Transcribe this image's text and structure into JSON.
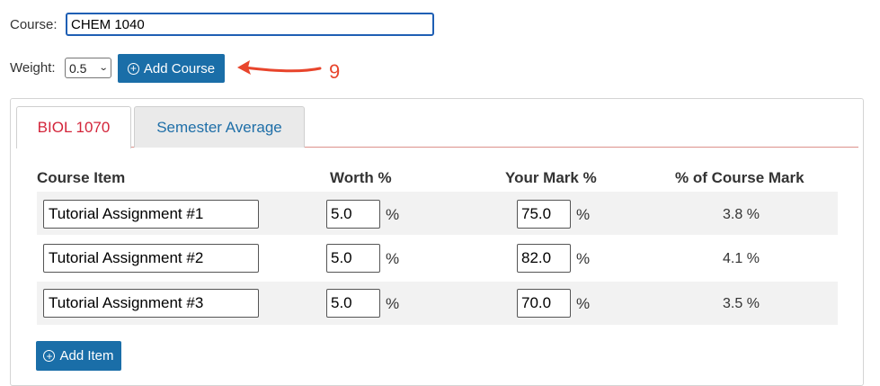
{
  "form": {
    "course_label": "Course:",
    "course_value": "CHEM 1040",
    "weight_label": "Weight:",
    "weight_value": "0.5",
    "add_course_label": "Add Course"
  },
  "annotation": {
    "number": "9",
    "color": "#e8452c"
  },
  "tabs": [
    {
      "label": "BIOL 1070",
      "active": true
    },
    {
      "label": "Semester Average",
      "active": false
    }
  ],
  "table": {
    "headers": [
      "Course Item",
      "Worth %",
      "Your Mark %",
      "% of Course Mark"
    ],
    "unit": "%",
    "rows": [
      {
        "item": "Tutorial Assignment #1",
        "worth": "5.0",
        "mark": "75.0",
        "result": "3.8 %"
      },
      {
        "item": "Tutorial Assignment #2",
        "worth": "5.0",
        "mark": "82.0",
        "result": "4.1 %"
      },
      {
        "item": "Tutorial Assignment #3",
        "worth": "5.0",
        "mark": "70.0",
        "result": "3.5 %"
      }
    ],
    "add_item_label": "Add Item"
  },
  "colors": {
    "accent": "#1a6ea8",
    "active_tab": "#d3253a",
    "inactive_tab": "#1f6fa8"
  }
}
